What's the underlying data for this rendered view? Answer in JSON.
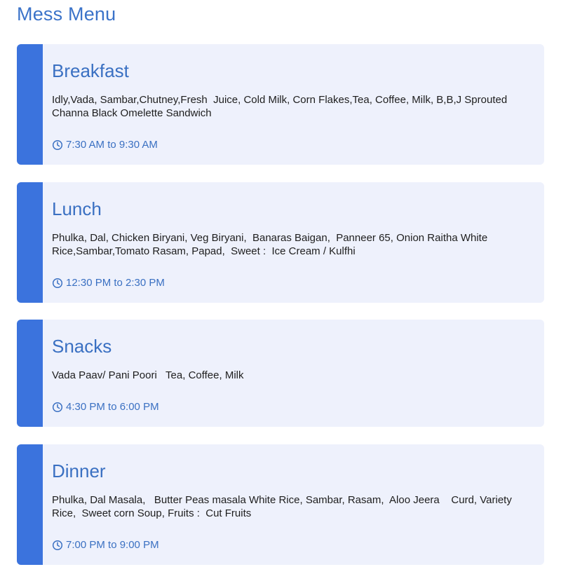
{
  "page_title": "Mess Menu",
  "colors": {
    "accent": "#3b73dd",
    "title": "#3a70c2",
    "card_bg": "#eef1fc"
  },
  "meals": [
    {
      "name": "Breakfast",
      "items": "Idly,Vada, Sambar,Chutney,Fresh  Juice, Cold Milk, Corn Flakes,Tea, Coffee, Milk, B,B,J Sprouted Channa Black Omelette Sandwich",
      "time": "7:30 AM to 9:30 AM",
      "icon": "clock-icon"
    },
    {
      "name": "Lunch",
      "items": "Phulka, Dal, Chicken Biryani, Veg Biryani,  Banaras Baigan,  Panneer 65, Onion Raitha White Rice,Sambar,Tomato Rasam, Papad,  Sweet :  Ice Cream / Kulfhi",
      "time": "12:30 PM to 2:30 PM",
      "icon": "clock-icon"
    },
    {
      "name": "Snacks",
      "items": "Vada Paav/ Pani Poori   Tea, Coffee, Milk",
      "time": "4:30 PM to 6:00 PM",
      "icon": "clock-icon"
    },
    {
      "name": "Dinner",
      "items": "Phulka, Dal Masala,   Butter Peas masala White Rice, Sambar, Rasam,  Aloo Jeera    Curd, Variety Rice,  Sweet corn Soup, Fruits :  Cut Fruits",
      "time": "7:00 PM to 9:00 PM",
      "icon": "clock-icon"
    }
  ]
}
